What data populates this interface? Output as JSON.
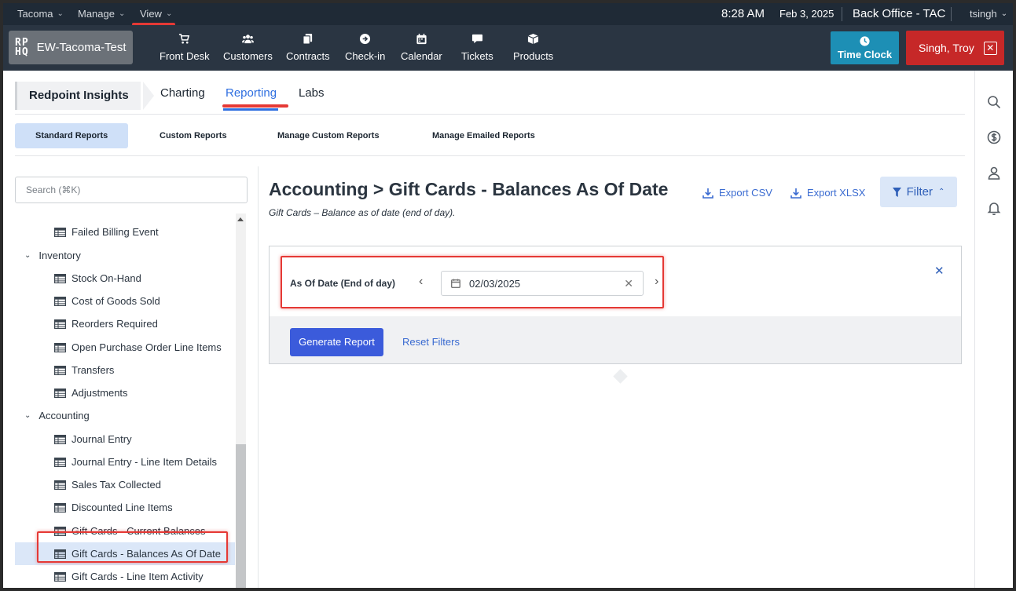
{
  "topbar": {
    "menus": [
      {
        "label": "Tacoma"
      },
      {
        "label": "Manage"
      },
      {
        "label": "View"
      }
    ],
    "time": "8:28 AM",
    "date": "Feb 3, 2025",
    "location": "Back Office - TAC",
    "username": "tsingh"
  },
  "navbar": {
    "brand_logo_top": "RP",
    "brand_logo_bottom": "HQ",
    "brand_name": "EW-Tacoma-Test",
    "items": [
      {
        "label": "Front Desk",
        "icon": "cart-icon"
      },
      {
        "label": "Customers",
        "icon": "users-icon"
      },
      {
        "label": "Contracts",
        "icon": "copy-icon"
      },
      {
        "label": "Check-in",
        "icon": "arrow-circle-icon"
      },
      {
        "label": "Calendar",
        "icon": "calendar-icon"
      },
      {
        "label": "Tickets",
        "icon": "chat-icon"
      },
      {
        "label": "Products",
        "icon": "box-icon"
      }
    ],
    "time_clock_label": "Time Clock",
    "user_button_label": "Singh, Troy"
  },
  "insights": {
    "title": "Redpoint Insights",
    "tabs": [
      {
        "label": "Charting"
      },
      {
        "label": "Reporting"
      },
      {
        "label": "Labs"
      }
    ],
    "active_tab": "Reporting"
  },
  "subtabs": [
    {
      "label": "Standard Reports"
    },
    {
      "label": "Custom Reports"
    },
    {
      "label": "Manage Custom Reports"
    },
    {
      "label": "Manage Emailed Reports"
    }
  ],
  "sidebar": {
    "search_placeholder": "Search (⌘K)",
    "tree": [
      {
        "type": "leaf",
        "label": "Failed Billing Event"
      },
      {
        "type": "group",
        "label": "Inventory"
      },
      {
        "type": "leaf",
        "label": "Stock On-Hand"
      },
      {
        "type": "leaf",
        "label": "Cost of Goods Sold"
      },
      {
        "type": "leaf",
        "label": "Reorders Required"
      },
      {
        "type": "leaf",
        "label": "Open Purchase Order Line Items"
      },
      {
        "type": "leaf",
        "label": "Transfers"
      },
      {
        "type": "leaf",
        "label": "Adjustments"
      },
      {
        "type": "group",
        "label": "Accounting"
      },
      {
        "type": "leaf",
        "label": "Journal Entry"
      },
      {
        "type": "leaf",
        "label": "Journal Entry - Line Item Details"
      },
      {
        "type": "leaf",
        "label": "Sales Tax Collected"
      },
      {
        "type": "leaf",
        "label": "Discounted Line Items"
      },
      {
        "type": "leaf",
        "label": "Gift Cards - Current Balances"
      },
      {
        "type": "leaf",
        "label": "Gift Cards - Balances As Of Date",
        "selected": true
      },
      {
        "type": "leaf",
        "label": "Gift Cards - Line Item Activity"
      }
    ]
  },
  "main": {
    "title": "Accounting > Gift Cards - Balances As Of Date",
    "subtitle": "Gift Cards – Balance as of date (end of day).",
    "export_csv": "Export CSV",
    "export_xlsx": "Export XLSX",
    "filter_label": "Filter",
    "filter": {
      "label": "As Of Date (End of day)",
      "date_value": "02/03/2025"
    },
    "generate_label": "Generate Report",
    "reset_label": "Reset Filters"
  },
  "colors": {
    "accent": "#2f6fe0",
    "primary_button": "#3b5bdb",
    "time_clock": "#1d8fb5",
    "user_button": "#c62828",
    "highlight": "#e53935"
  }
}
